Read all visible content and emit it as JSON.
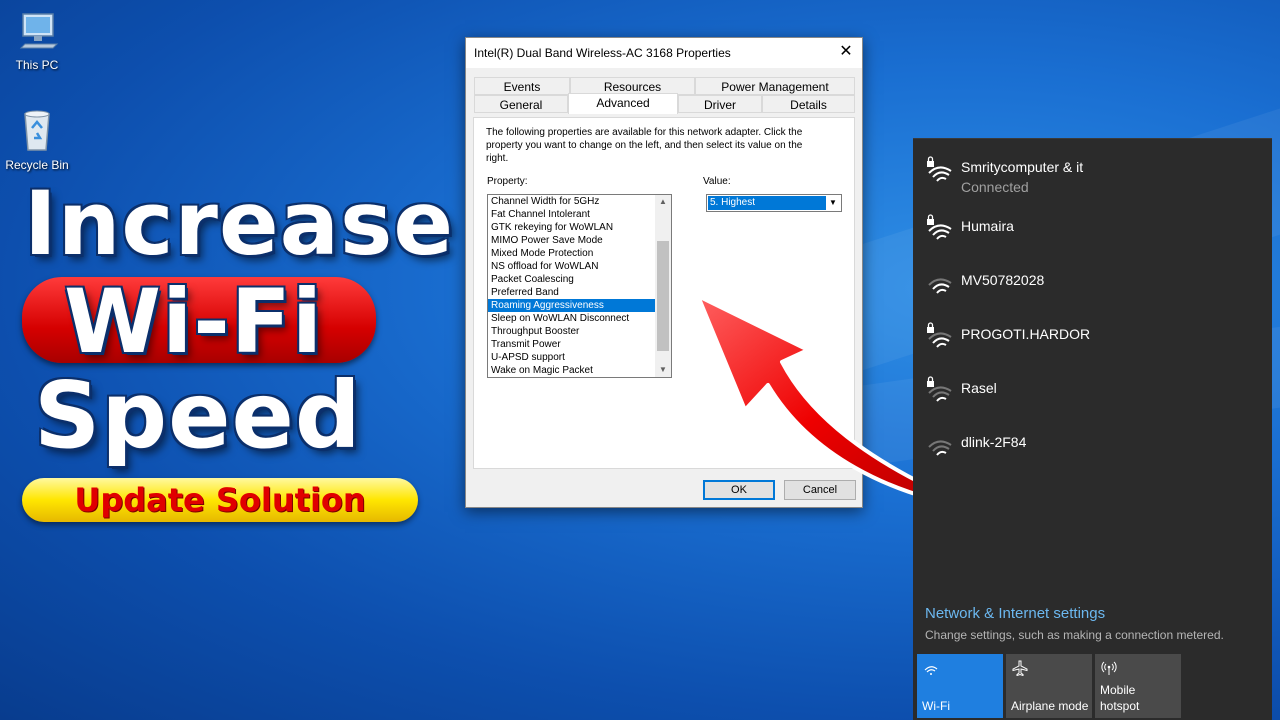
{
  "desktop": {
    "icons": [
      {
        "label": "This PC",
        "icon": "computer-icon"
      },
      {
        "label": "Recycle Bin",
        "icon": "recycle-bin-icon"
      }
    ]
  },
  "headline": {
    "line1": "Increase",
    "line2": "Wi-Fi",
    "line3": "Speed",
    "badge": "Update Solution"
  },
  "dialog": {
    "title": "Intel(R) Dual Band Wireless-AC 3168 Properties",
    "tabs_row1": [
      "Events",
      "Resources",
      "Power Management"
    ],
    "tabs_row2": [
      "General",
      "Advanced",
      "Driver",
      "Details"
    ],
    "active_tab": "Advanced",
    "description": "The following properties are available for this network adapter. Click the property you want to change on the left, and then select its value on the right.",
    "property_label": "Property:",
    "value_label": "Value:",
    "properties": [
      "Channel Width for 5GHz",
      "Fat Channel Intolerant",
      "GTK rekeying for WoWLAN",
      "MIMO Power Save Mode",
      "Mixed Mode Protection",
      "NS offload for WoWLAN",
      "Packet Coalescing",
      "Preferred Band",
      "Roaming Aggressiveness",
      "Sleep on WoWLAN Disconnect",
      "Throughput Booster",
      "Transmit Power",
      "U-APSD support",
      "Wake on Magic Packet"
    ],
    "selected_property": "Roaming Aggressiveness",
    "value_selected": "5. Highest",
    "ok_label": "OK",
    "cancel_label": "Cancel"
  },
  "network": {
    "networks": [
      {
        "name": "Smritycomputer & it",
        "status": "Connected",
        "secured": true
      },
      {
        "name": "Humaira",
        "secured": true
      },
      {
        "name": "MV50782028",
        "secured": false
      },
      {
        "name": "PROGOTI.HARDOR",
        "secured": true
      },
      {
        "name": "Rasel",
        "secured": true
      },
      {
        "name": "dlink-2F84",
        "secured": false
      }
    ],
    "settings_link": "Network & Internet settings",
    "settings_sub": "Change settings, such as making a connection metered.",
    "tiles": [
      {
        "label": "Wi-Fi",
        "active": true,
        "icon": "wifi-icon"
      },
      {
        "label": "Airplane mode",
        "active": false,
        "icon": "airplane-icon"
      },
      {
        "label": "Mobile hotspot",
        "active": false,
        "icon": "hotspot-icon"
      }
    ]
  },
  "colors": {
    "accent": "#0078d7",
    "headline_red": "#d50000",
    "badge_yellow": "#ffe600",
    "flyout_bg": "#2b2b2b",
    "link_blue": "#6cb8f0"
  }
}
